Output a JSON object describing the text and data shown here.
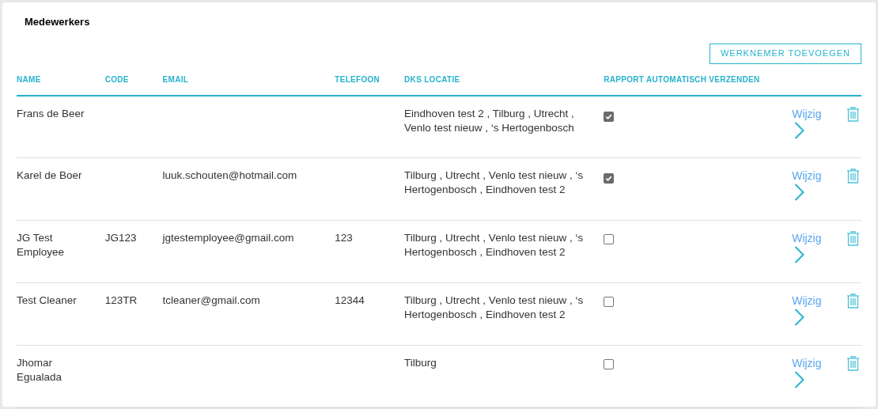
{
  "title": "Medewerkers",
  "add_button": "WERKNEMER TOEVOEGEN",
  "columns": [
    "NAME",
    "CODE",
    "EMAIL",
    "TELEFOON",
    "DKS LOCATIE",
    "RAPPORT AUTOMATISCH VERZENDEN"
  ],
  "rows": [
    {
      "name": "Frans de Beer",
      "code": "",
      "email": "",
      "phone": "",
      "location": "Eindhoven test 2 , Tilburg , Utrecht , Venlo test nieuw , ‘s Hertogenbosch",
      "auto_report": true,
      "edit": "Wijzig"
    },
    {
      "name": "Karel de Boer",
      "code": "",
      "email": "luuk.schouten@hotmail.com",
      "phone": "",
      "location": "Tilburg , Utrecht , Venlo test nieuw , ‘s Hertogenbosch , Eindhoven test 2",
      "auto_report": true,
      "edit": "Wijzig"
    },
    {
      "name": "JG Test Employee",
      "code": "JG123",
      "email": "jgtestemployee@gmail.com",
      "phone": "123",
      "location": "Tilburg , Utrecht , Venlo test nieuw , ‘s Hertogenbosch , Eindhoven test 2",
      "auto_report": false,
      "edit": "Wijzig"
    },
    {
      "name": "Test Cleaner",
      "code": "123TR",
      "email": "tcleaner@gmail.com",
      "phone": "12344",
      "location": "Tilburg , Utrecht , Venlo test nieuw , ‘s Hertogenbosch , Eindhoven test 2",
      "auto_report": false,
      "edit": "Wijzig"
    },
    {
      "name": "Jhomar Egualada",
      "code": "",
      "email": "",
      "phone": "",
      "location": "Tilburg",
      "auto_report": false,
      "edit": "Wijzig"
    }
  ]
}
